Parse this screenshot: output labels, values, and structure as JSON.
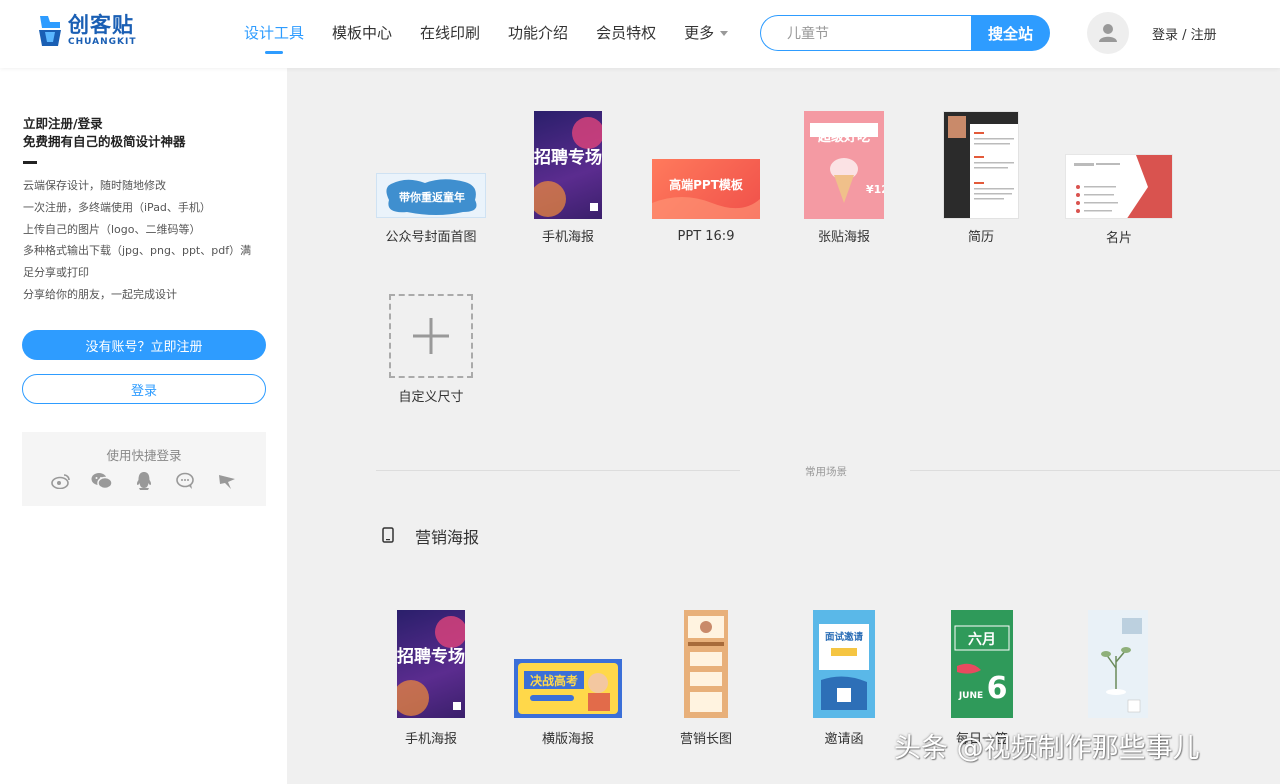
{
  "header": {
    "logo_cn": "创客贴",
    "logo_en": "CHUANGKIT",
    "nav": [
      {
        "label": "设计工具",
        "active": true
      },
      {
        "label": "模板中心"
      },
      {
        "label": "在线印刷"
      },
      {
        "label": "功能介绍"
      },
      {
        "label": "会员特权"
      },
      {
        "label": "更多"
      }
    ],
    "search_placeholder": "儿童节",
    "search_button": "搜全站",
    "login_label": "登录 / 注册",
    "accent": "#2e9cff"
  },
  "sidebar": {
    "title1": "立即注册/登录",
    "title2": "免费拥有自己的极简设计神器",
    "features": [
      "云端保存设计，随时随地修改",
      "一次注册，多终端使用（iPad、手机）",
      "上传自己的图片（logo、二维码等）",
      "多种格式输出下载（jpg、png、ppt、pdf）满",
      "足分享或打印",
      "分享给你的朋友，一起完成设计"
    ],
    "register_button": "没有账号？立即注册",
    "login_button": "登录",
    "quick_login_title": "使用快捷登录",
    "quick_icons": [
      "weibo-icon",
      "wechat-icon",
      "qq-icon",
      "chat-icon",
      "bird-icon"
    ]
  },
  "main": {
    "sizes": [
      {
        "label": "公众号封面首图",
        "thumb_text": "带你重返童年"
      },
      {
        "label": "手机海报",
        "thumb_text": "招聘专场"
      },
      {
        "label": "PPT 16:9",
        "thumb_text": "高端PPT模板"
      },
      {
        "label": "张贴海报",
        "thumb_text": "超级好吃"
      },
      {
        "label": "简历",
        "thumb_text": ""
      },
      {
        "label": "名片",
        "thumb_text": ""
      }
    ],
    "custom_size_label": "自定义尺寸",
    "divider_text": "常用场景",
    "section_title": "营销海报",
    "scenes": [
      {
        "label": "手机海报",
        "thumb_text": "招聘专场"
      },
      {
        "label": "横版海报",
        "thumb_text": "决战高考"
      },
      {
        "label": "营销长图",
        "thumb_text": ""
      },
      {
        "label": "邀请函",
        "thumb_text": "面试邀请"
      },
      {
        "label": "每日一签",
        "thumb_text": "六月"
      },
      {
        "label": "",
        "thumb_text": ""
      }
    ]
  },
  "watermark": "头条 @视频制作那些事儿"
}
